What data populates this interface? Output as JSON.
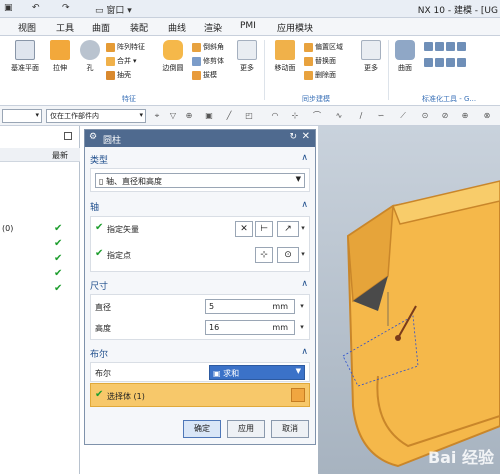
{
  "titlebar": {
    "window_menu": "窗口",
    "title": "NX 10 - 建模 - [UG"
  },
  "menubar": {
    "tabs": [
      "视图",
      "工具",
      "曲面",
      "装配",
      "曲线",
      "渲染",
      "PMI",
      "应用模块"
    ]
  },
  "ribbon": {
    "big_buttons": [
      "基准平面",
      "拉伸",
      "孔",
      "边倒圆",
      "更多",
      "移动面",
      "更多",
      "曲面"
    ],
    "col_feature": [
      "阵列特征",
      "合并",
      "抽壳"
    ],
    "col_detail": [
      "倒斜角",
      "修剪体",
      "拔模"
    ],
    "col_sync": [
      "偏置区域",
      "替换面",
      "删除面"
    ],
    "groups": {
      "feature": "特征",
      "sync": "同步建模",
      "std": "标准化工具 - G..."
    },
    "colors": {
      "accent": "#3b72b8"
    }
  },
  "filterbar": {
    "combo2": "仅在工作部件内"
  },
  "navigator": {
    "col_latest": "最新",
    "row_text": "(0)",
    "checks": 5
  },
  "dialog": {
    "title": "圆柱",
    "sections": {
      "type": "类型",
      "axis": "轴",
      "dims": "尺寸",
      "bool": "布尔"
    },
    "type_value": "轴、直径和高度",
    "specify_vector": "指定矢量",
    "specify_point": "指定点",
    "diameter_label": "直径",
    "diameter_value": "5",
    "height_label": "高度",
    "height_value": "16",
    "unit": "mm",
    "bool_label": "布尔",
    "bool_value": "求和",
    "select_body": "选择体 (1)",
    "ok": "确定",
    "apply": "应用",
    "cancel": "取消"
  },
  "watermark": "Bai 经验",
  "colors": {
    "dialog_header": "#4f6a8f",
    "highlight": "#f7c86a",
    "check": "#1e9e2e",
    "part": "#f5b84a"
  }
}
